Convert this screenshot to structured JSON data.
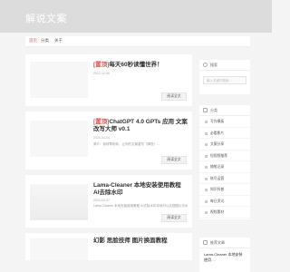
{
  "hero": {
    "title": "解说文案"
  },
  "nav": {
    "items": [
      "首页",
      "分类",
      "关于"
    ],
    "active_index": 0,
    "accent": "#d9534f"
  },
  "posts": [
    {
      "tag": "[置顶]",
      "title": "每天60秒读懂世界！",
      "date": "2022-12-30",
      "excerpt": "...",
      "more_label": "阅读全文"
    },
    {
      "tag": "[置顶]",
      "title": "ChatGPT 4.0 GPTs 应用 文案改写大师 v0.1",
      "date": "2024-04-04",
      "excerpt": "简介：我将帮助你，让你的文案重写（降低）...",
      "more_label": "阅读全文"
    },
    {
      "tag": "",
      "title": "Lama-Cleaner 本地安装使用教程 AI去除水印",
      "date": "2024-03-27",
      "excerpt": "Lama-Cleaner 本地安装使用教程 AI去除水印本地可以实现图片去水印...",
      "more_label": "阅读全文"
    },
    {
      "tag": "",
      "title": "幻影 思脸技师 图片换面教程",
      "date": "",
      "excerpt": "",
      "more_label": ""
    }
  ],
  "sidebar": {
    "search": {
      "label": "搜索",
      "placeholder": "输入关键词搜索…"
    },
    "categories": {
      "label": "分类",
      "items": [
        "写作模板",
        "必看影片",
        "文案分享",
        "短视频推荐",
        "随笔记录",
        "账号运营",
        "知识科普",
        "每日资讯",
        "视频素材"
      ]
    },
    "recommend": {
      "label": "推荐文章",
      "first": "Lama-Cleaner 本地安装使用…"
    }
  }
}
